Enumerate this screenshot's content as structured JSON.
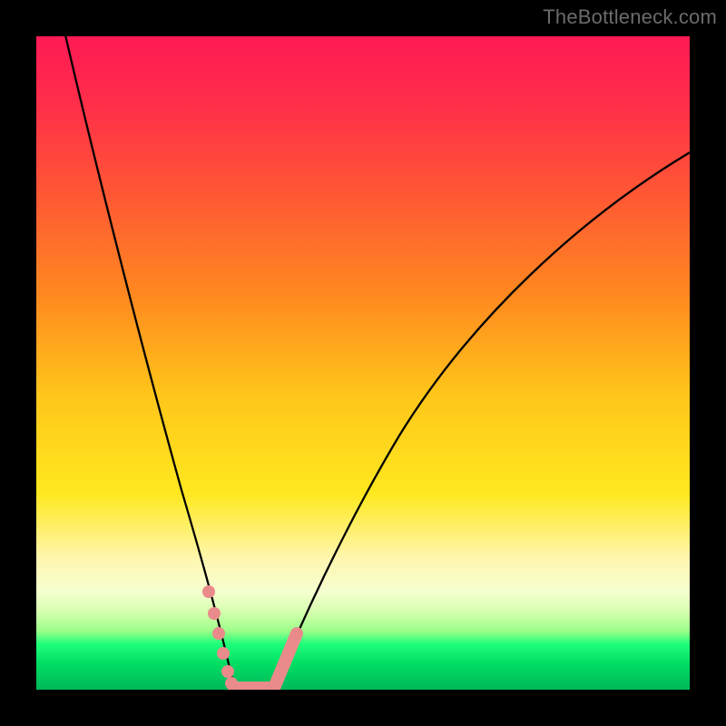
{
  "watermark": {
    "text": "TheBottleneck.com"
  },
  "chart_data": {
    "type": "line",
    "title": "",
    "xlabel": "",
    "ylabel": "",
    "xlim": [
      0,
      100
    ],
    "ylim": [
      0,
      100
    ],
    "background_gradient": {
      "stops": [
        {
          "offset": 0.0,
          "color": "#ff1a55"
        },
        {
          "offset": 0.1,
          "color": "#ff2d4a"
        },
        {
          "offset": 0.25,
          "color": "#ff5a33"
        },
        {
          "offset": 0.4,
          "color": "#ff8a1f"
        },
        {
          "offset": 0.55,
          "color": "#ffc61a"
        },
        {
          "offset": 0.7,
          "color": "#ffe81f"
        },
        {
          "offset": 0.8,
          "color": "#fff6b0"
        },
        {
          "offset": 0.85,
          "color": "#f6ffd0"
        },
        {
          "offset": 0.88,
          "color": "#d7ffb0"
        },
        {
          "offset": 0.91,
          "color": "#9cff8a"
        },
        {
          "offset": 0.93,
          "color": "#1fff7a"
        },
        {
          "offset": 0.96,
          "color": "#00de64"
        },
        {
          "offset": 1.0,
          "color": "#00b85a"
        }
      ]
    },
    "series": [
      {
        "name": "left-curve",
        "x": [
          4,
          6,
          8,
          10,
          12,
          14,
          16,
          18,
          20,
          22,
          24,
          26,
          28,
          29,
          30
        ],
        "y": [
          100,
          90,
          80,
          70,
          60,
          50,
          42,
          34,
          27,
          21,
          15,
          10,
          6,
          3,
          0
        ]
      },
      {
        "name": "right-curve",
        "x": [
          36,
          38,
          40,
          44,
          48,
          52,
          56,
          60,
          64,
          70,
          76,
          82,
          88,
          94,
          100
        ],
        "y": [
          0,
          4,
          8,
          15,
          22,
          28,
          34,
          40,
          46,
          54,
          61,
          67,
          73,
          78,
          82
        ]
      }
    ],
    "highlight": {
      "color": "#e98b8b",
      "stroke_width": 14,
      "points_in_data_coords": [
        {
          "seg": "left",
          "x": [
            25,
            26,
            27,
            28,
            29
          ],
          "y": [
            12,
            9,
            6,
            3,
            1
          ]
        },
        {
          "seg": "floor",
          "x": [
            29,
            31,
            33,
            35,
            36
          ],
          "y": [
            0.5,
            0.5,
            0.5,
            0.5,
            0.5
          ]
        },
        {
          "seg": "right",
          "x": [
            36,
            37,
            38,
            39
          ],
          "y": [
            1,
            3,
            6,
            9
          ]
        }
      ]
    }
  }
}
